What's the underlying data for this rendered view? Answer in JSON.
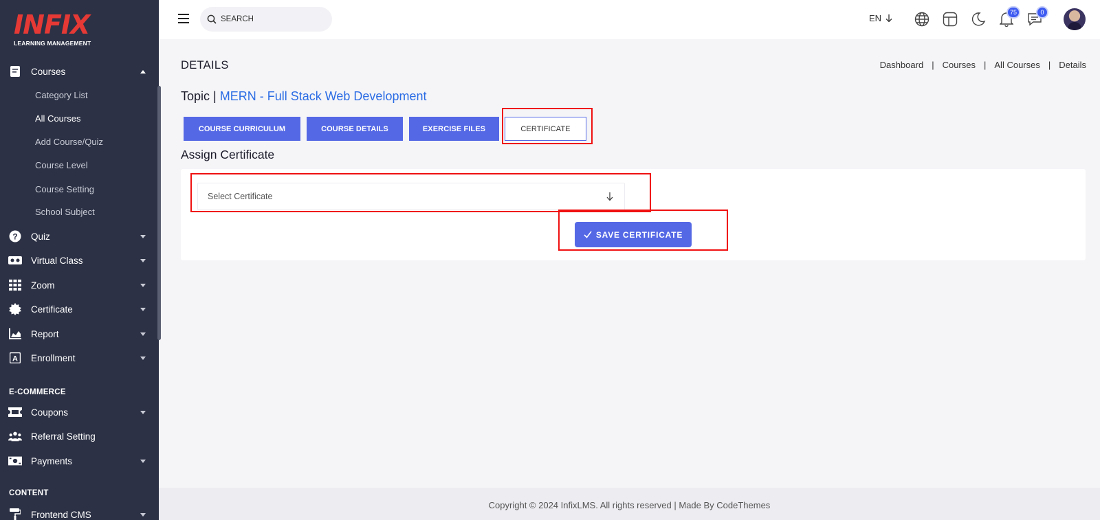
{
  "brand": {
    "logo_text": "INFIX",
    "logo_sub": "LEARNING MANAGEMENT"
  },
  "sidebar": {
    "courses_label": "Courses",
    "sub_items": [
      "Category List",
      "All Courses",
      "Add Course/Quiz",
      "Course Level",
      "Course Setting",
      "School Subject"
    ],
    "items": [
      "Quiz",
      "Virtual Class",
      "Zoom",
      "Certificate",
      "Report",
      "Enrollment"
    ],
    "section_ecommerce": "E-COMMERCE",
    "ecommerce_items": [
      "Coupons",
      "Referral Setting",
      "Payments"
    ],
    "section_content": "CONTENT",
    "content_items": [
      "Frontend CMS"
    ]
  },
  "header": {
    "search_placeholder": "SEARCH",
    "language": "EN",
    "notifications_count": "75",
    "messages_count": "0"
  },
  "page": {
    "title": "DETAILS",
    "breadcrumb": [
      "Dashboard",
      "Courses",
      "All Courses",
      "Details"
    ],
    "topic_label": "Topic |",
    "course_name": "MERN - Full Stack Web Development",
    "tabs": [
      "COURSE CURRICULUM",
      "COURSE DETAILS",
      "EXERCISE FILES",
      "CERTIFICATE"
    ],
    "section_heading": "Assign Certificate",
    "select_value": "Select Certificate",
    "save_label": "SAVE CERTIFICATE"
  },
  "footer": {
    "text": "Copyright © 2024 InfixLMS. All rights reserved | Made By CodeThemes"
  },
  "colors": {
    "sidebar_bg": "#2c3145",
    "accent": "#5468e5",
    "link": "#2b6ce4",
    "highlight": "#f01010"
  }
}
